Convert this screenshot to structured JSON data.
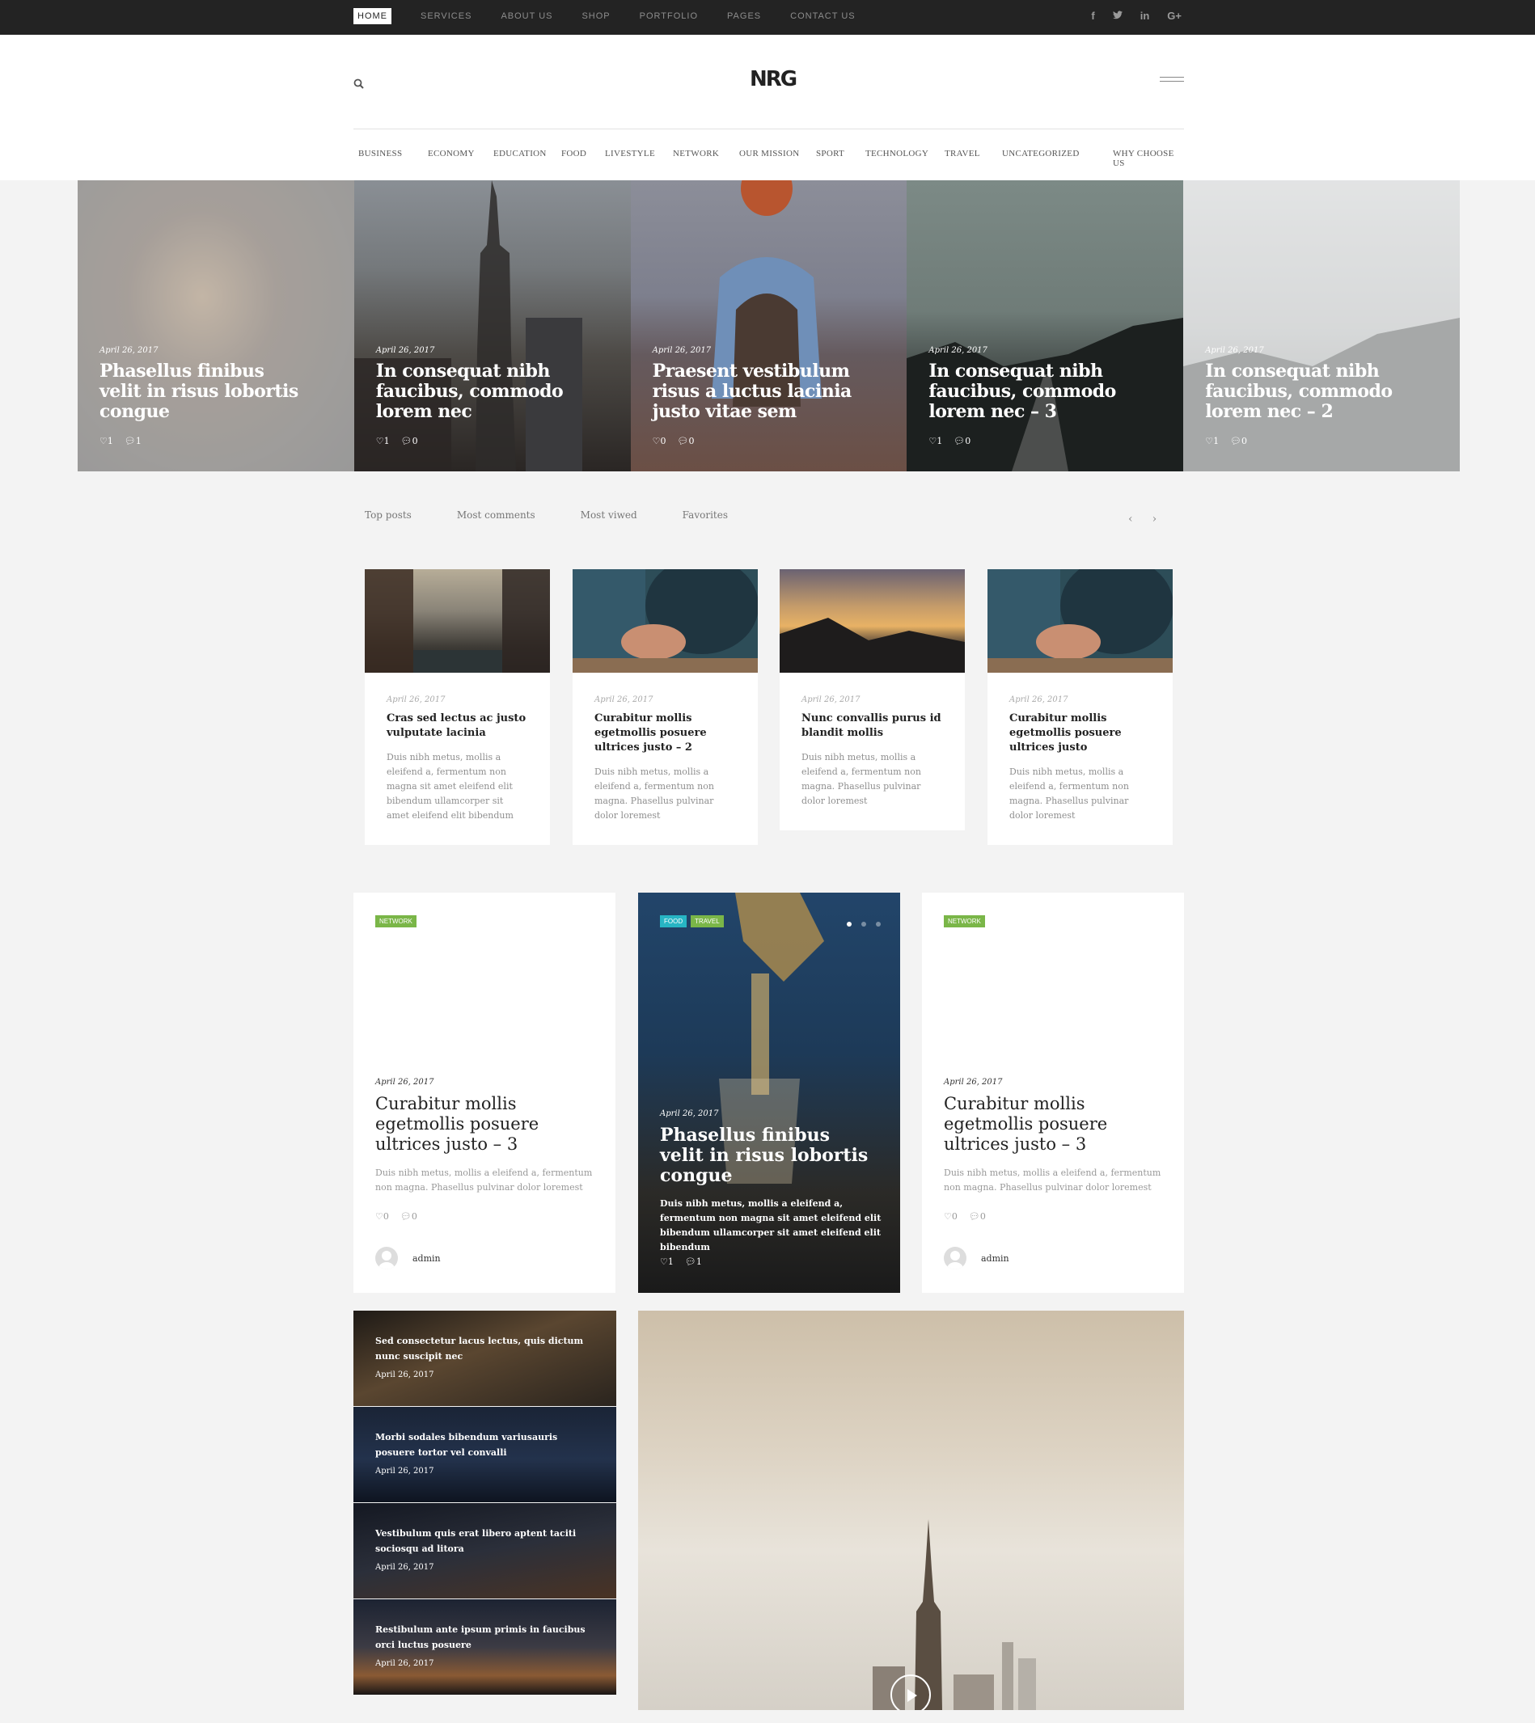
{
  "topbar": {
    "nav": [
      "HOME",
      "SERVICES",
      "ABOUT US",
      "SHOP",
      "PORTFOLIO",
      "PAGES",
      "CONTACT US"
    ],
    "social_icons": [
      "facebook-icon",
      "twitter-icon",
      "linkedin-icon",
      "google-plus-icon"
    ],
    "social_glyphs": [
      "f",
      "t",
      "in",
      "G+"
    ]
  },
  "header": {
    "logo": "NRG",
    "categories": [
      "BUSINESS",
      "ECONOMY",
      "EDUCATION",
      "FOOD",
      "LIVESTYLE",
      "NETWORK",
      "OUR MISSION",
      "SPORT",
      "TECHNOLOGY",
      "TRAVEL",
      "UNCATEGORIZED",
      "WHY CHOOSE US"
    ]
  },
  "slider": [
    {
      "date": "April 26, 2017",
      "title": "Phasellus finibus velit in risus lobortis congue",
      "likes": "1",
      "comments": "1"
    },
    {
      "date": "April 26, 2017",
      "title": "In consequat nibh faucibus, commodo lorem nec",
      "likes": "1",
      "comments": "0"
    },
    {
      "date": "April 26, 2017",
      "title": "Praesent vestibulum risus a luctus lacinia justo vitae sem",
      "likes": "0",
      "comments": "0"
    },
    {
      "date": "April 26, 2017",
      "title": "In consequat nibh faucibus, commodo lorem nec – 3",
      "likes": "1",
      "comments": "0"
    },
    {
      "date": "April 26, 2017",
      "title": "In consequat nibh faucibus, commodo lorem nec – 2",
      "likes": "1",
      "comments": "0"
    }
  ],
  "tabs": [
    "Top posts",
    "Most comments",
    "Most viwed",
    "Favorites"
  ],
  "arrows": {
    "prev": "‹",
    "next": "›"
  },
  "cards": [
    {
      "date": "April 26, 2017",
      "title": "Cras sed lectus ac justo vulputate lacinia",
      "excerpt": "Duis nibh metus, mollis a eleifend a, fermentum non magna sit amet eleifend elit bibendum ullamcorper sit amet eleifend elit bibendum"
    },
    {
      "date": "April 26, 2017",
      "title": "Curabitur mollis egetmollis posuere ultrices justo – 2",
      "excerpt": "Duis nibh metus, mollis a eleifend a, fermentum non magna. Phasellus pulvinar dolor loremest"
    },
    {
      "date": "April 26, 2017",
      "title": "Nunc convallis purus id blandit mollis",
      "excerpt": "Duis nibh metus, mollis a eleifend a, fermentum non magna. Phasellus pulvinar dolor loremest"
    },
    {
      "date": "April 26, 2017",
      "title": "Curabitur mollis egetmollis posuere ultrices justo",
      "excerpt": "Duis nibh metus, mollis a eleifend a, fermentum non magna. Phasellus pulvinar dolor loremest"
    }
  ],
  "posts": [
    {
      "tags": [
        "NETWORK"
      ],
      "date": "April 26, 2017",
      "title": "Curabitur mollis egetmollis posuere ultrices justo – 3",
      "excerpt": "Duis nibh metus, mollis a eleifend a, fermentum non magna. Phasellus pulvinar dolor loremest",
      "likes": "0",
      "comments": "0",
      "author": "admin"
    },
    {
      "tags": [
        "FOOD",
        "TRAVEL"
      ],
      "date": "April 26, 2017",
      "title": "Phasellus finibus velit in risus lobortis congue",
      "excerpt": "Duis nibh metus, mollis a eleifend a, fermentum non magna sit amet eleifend elit bibendum ullamcorper sit amet eleifend elit bibendum",
      "likes": "1",
      "comments": "1"
    },
    {
      "tags": [
        "NETWORK"
      ],
      "date": "April 26, 2017",
      "title": "Curabitur mollis egetmollis posuere ultrices justo – 3",
      "excerpt": "Duis nibh metus, mollis a eleifend a, fermentum non magna. Phasellus pulvinar dolor loremest",
      "likes": "0",
      "comments": "0",
      "author": "admin"
    }
  ],
  "tag_colors": {
    "network": "#7ab648",
    "food": "#27b5c4",
    "travel": "#7ab648"
  },
  "list": [
    {
      "title": "Sed consectetur lacus lectus, quis dictum nunc suscipit nec",
      "date": "April 26, 2017"
    },
    {
      "title": "Morbi sodales bibendum variusauris posuere tortor vel convalli",
      "date": "April 26, 2017"
    },
    {
      "title": "Vestibulum quis erat libero aptent taciti sociosqu ad litora",
      "date": "April 26, 2017"
    },
    {
      "title": "Restibulum ante ipsum primis in faucibus orci luctus posuere",
      "date": "April 26, 2017"
    }
  ]
}
